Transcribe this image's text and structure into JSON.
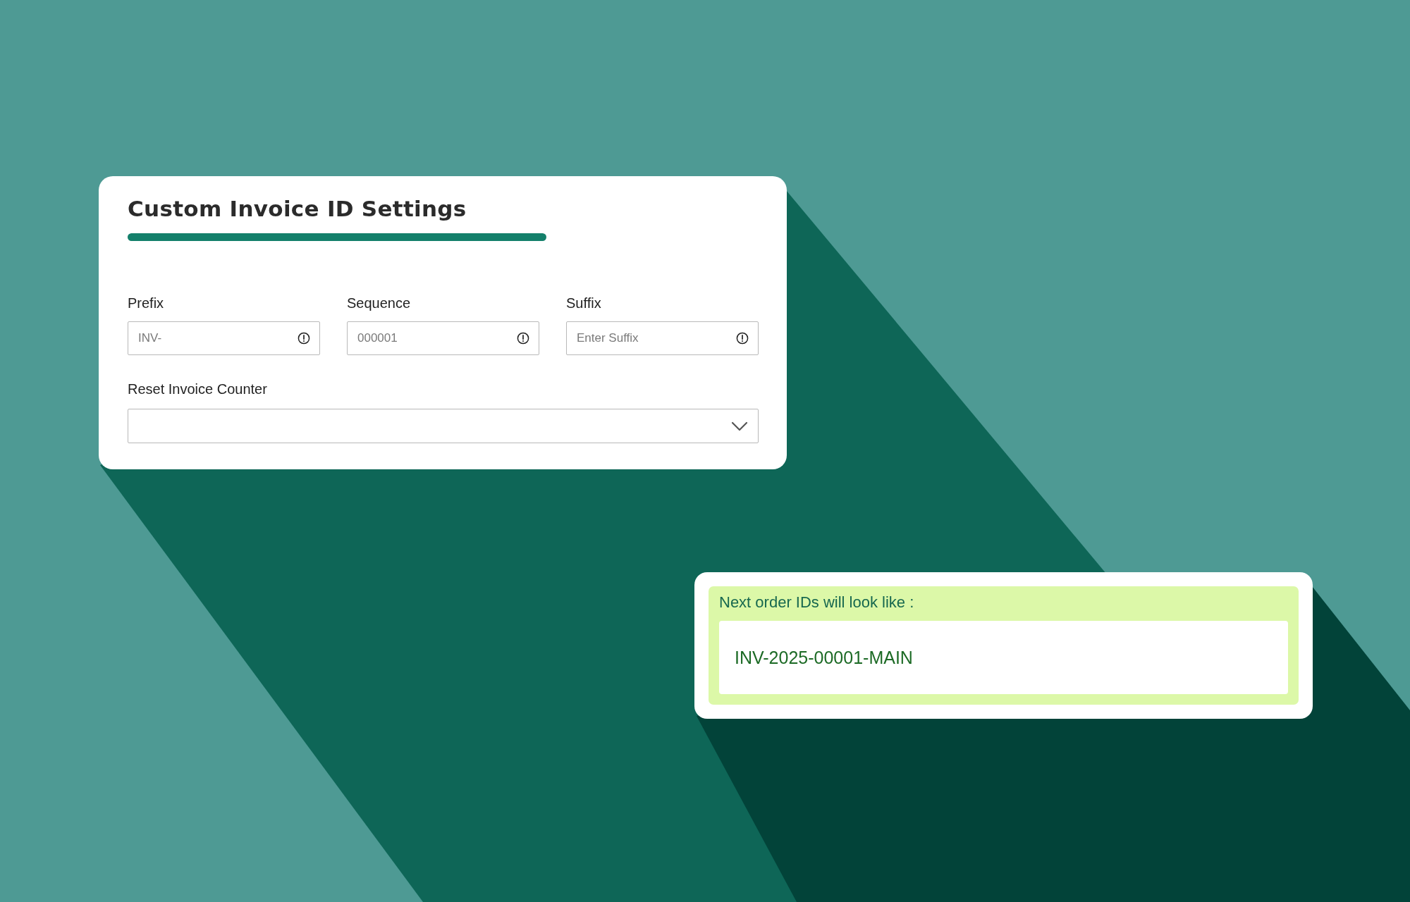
{
  "settings_card": {
    "title": "Custom Invoice ID Settings",
    "fields": [
      {
        "label": "Prefix",
        "placeholder": "INV-"
      },
      {
        "label": "Sequence",
        "placeholder": "000001"
      },
      {
        "label": "Suffix",
        "placeholder": "Enter Suffix"
      }
    ],
    "reset_counter": {
      "label": "Reset Invoice Counter"
    }
  },
  "preview_card": {
    "label": "Next order IDs will look like :",
    "example": "INV-2025-00001-MAIN"
  }
}
